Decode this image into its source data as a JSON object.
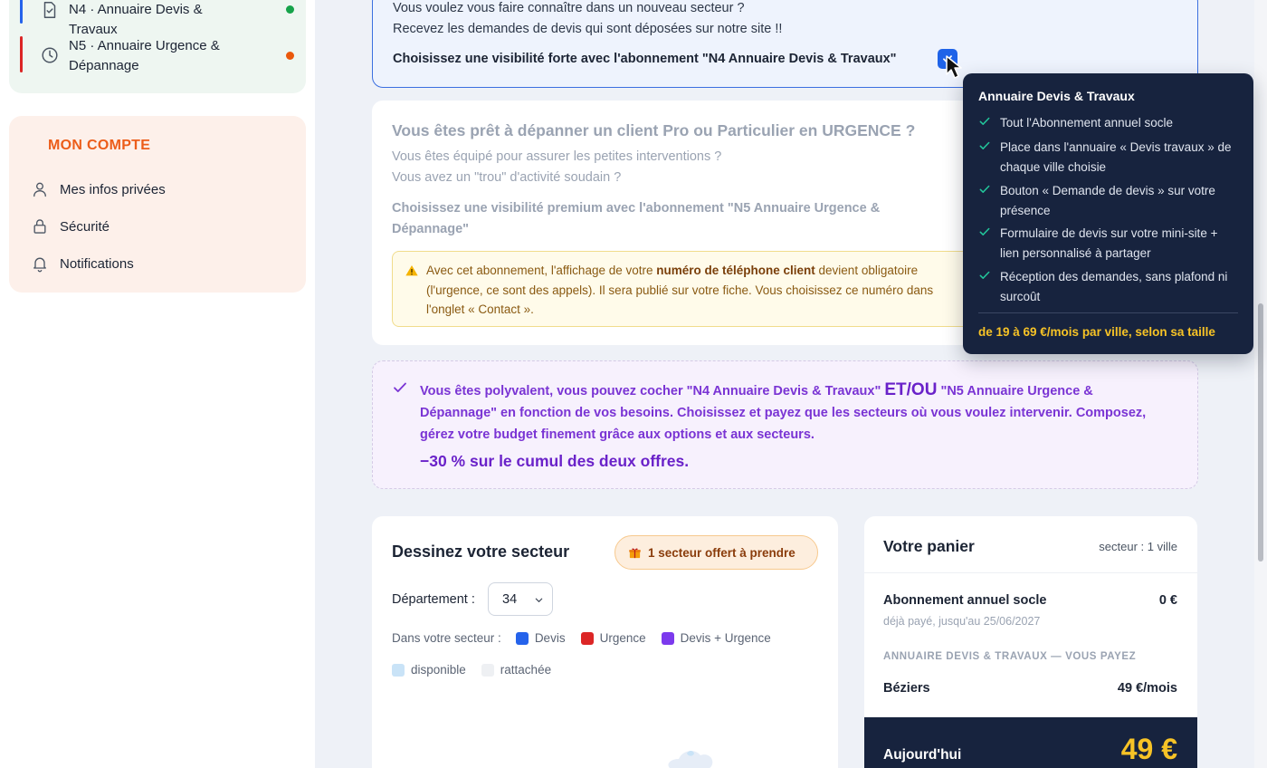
{
  "sidebar": {
    "nav": [
      {
        "label": "N4 · Annuaire Devis & Travaux",
        "bar_color": "#2563eb",
        "dot_color": "#16a34a"
      },
      {
        "label": "N5 · Annuaire Urgence & Dépannage",
        "bar_color": "#dc2626",
        "dot_color": "#ea580c"
      }
    ],
    "account": {
      "title": "MON COMPTE",
      "items": [
        {
          "label": "Mes infos privées",
          "icon": "user-icon"
        },
        {
          "label": "Sécurité",
          "icon": "lock-icon"
        },
        {
          "label": "Notifications",
          "icon": "bell-icon"
        }
      ]
    }
  },
  "n4_card": {
    "line1": "Vous voulez vous faire connaître dans un nouveau secteur ?",
    "line2": "Recevez les demandes de devis qui sont déposées sur notre site !!",
    "cta": "Choisissez une visibilité forte avec l'abonnement \"N4 Annuaire Devis & Travaux\"",
    "checked": true
  },
  "n5_card": {
    "title": "Vous êtes prêt à dépanner un client Pro ou Particulier en URGENCE ?",
    "line1": "Vous êtes équipé pour assurer les petites interventions ?",
    "line2": "Vous avez un \"trou\" d'activité soudain ?",
    "cta": "Choisissez une visibilité premium avec l'abonnement \"N5 Annuaire Urgence & Dépannage\"",
    "warning_pre": "Avec cet abonnement, l'affichage de votre ",
    "warning_bold": "numéro de téléphone client",
    "warning_post": " devient obligatoire (l'urgence, ce sont des appels). Il sera publié sur votre fiche. Vous choisissez ce numéro dans l'onglet « Contact »."
  },
  "poly_card": {
    "text_a": "Vous êtes polyvalent, vous pouvez cocher \"N4 Annuaire Devis & Travaux\" ",
    "text_big": "ET/OU",
    "text_b": " \"N5 Annuaire Urgence & Dépannage\" en fonction de vos besoins. Choisissez et payez que les secteurs où vous voulez intervenir. Composez, gérez votre budget finement grâce aux options et aux secteurs.",
    "promo": "−30 % sur le cumul des deux offres."
  },
  "sector_card": {
    "title": "Dessinez votre secteur",
    "badge": "1 secteur offert  à prendre",
    "dept_label": "Département :",
    "dept_value": "34",
    "legend_label": "Dans votre secteur :",
    "legend": [
      {
        "label": "Devis",
        "color": "#2563eb"
      },
      {
        "label": "Urgence",
        "color": "#dc2626"
      },
      {
        "label": "Devis + Urgence",
        "color": "#7c3aed"
      }
    ],
    "legend2": [
      {
        "label": "disponible",
        "color": "#c9e3f7"
      },
      {
        "label": "rattachée",
        "color": "#eef0f3"
      }
    ]
  },
  "basket": {
    "title": "Votre panier",
    "sector_info": "secteur : 1 ville",
    "base_label": "Abonnement annuel socle",
    "base_value": "0 €",
    "base_sub": "déjà payé, jusqu'au 25/06/2027",
    "section": "ANNUAIRE DEVIS & TRAVAUX — VOUS PAYEZ",
    "city": "Béziers",
    "city_price": "49 €/mois",
    "total_label": "Aujourd'hui",
    "total_value": "49 €"
  },
  "tooltip": {
    "title": "Annuaire Devis & Travaux",
    "items": [
      "Tout l'Abonnement annuel socle",
      "Place dans l'annuaire « Devis travaux » de chaque ville choisie",
      "Bouton « Demande de devis » sur votre présence",
      "Formulaire de devis sur votre mini-site + lien personnalisé à partager",
      "Réception des demandes, sans plafond ni surcoût"
    ],
    "price": "de 19 à 69 €/mois par ville, selon sa taille"
  }
}
